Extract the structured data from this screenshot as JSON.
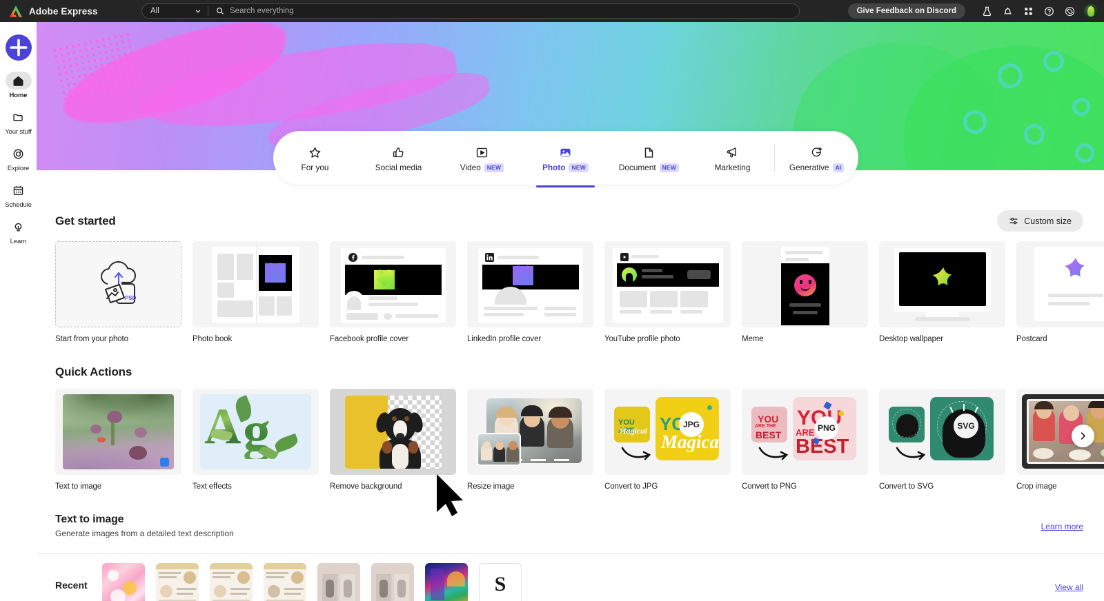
{
  "topbar": {
    "brand": "Adobe Express",
    "scope_value": "All",
    "search_placeholder": "Search everything",
    "search_value": "",
    "feedback_button": "Give Feedback on Discord",
    "icons": [
      "beaker-icon",
      "bell-icon",
      "apps-grid-icon",
      "help-icon",
      "creative-cloud-icon",
      "avatar"
    ]
  },
  "sidebar": {
    "create_button": "+",
    "items": [
      {
        "label": "Home",
        "icon": "home-icon",
        "active": true
      },
      {
        "label": "Your stuff",
        "icon": "folder-icon",
        "active": false
      },
      {
        "label": "Explore",
        "icon": "compass-icon",
        "active": false
      },
      {
        "label": "Schedule",
        "icon": "calendar-icon",
        "active": false
      },
      {
        "label": "Learn",
        "icon": "lightbulb-icon",
        "active": false
      }
    ]
  },
  "tabs": [
    {
      "label": "For you",
      "icon": "star-icon",
      "badge": "",
      "active": false
    },
    {
      "label": "Social media",
      "icon": "thumbs-up-icon",
      "badge": "",
      "active": false
    },
    {
      "label": "Video",
      "icon": "video-icon",
      "badge": "NEW",
      "active": false
    },
    {
      "label": "Photo",
      "icon": "photo-icon",
      "badge": "NEW",
      "active": true
    },
    {
      "label": "Document",
      "icon": "document-icon",
      "badge": "NEW",
      "active": false
    },
    {
      "label": "Marketing",
      "icon": "megaphone-icon",
      "badge": "",
      "active": false
    },
    {
      "label": "Generative",
      "icon": "generative-ai-icon",
      "badge": "AI",
      "active": false
    }
  ],
  "get_started": {
    "title": "Get started",
    "custom_size_button": "Custom size",
    "cards": [
      {
        "label": "Start from your photo",
        "kind": "upload"
      },
      {
        "label": "Photo book",
        "kind": "photobook"
      },
      {
        "label": "Facebook profile cover",
        "kind": "facebook"
      },
      {
        "label": "LinkedIn profile cover",
        "kind": "linkedin"
      },
      {
        "label": "YouTube profile photo",
        "kind": "youtube"
      },
      {
        "label": "Meme",
        "kind": "meme"
      },
      {
        "label": "Desktop wallpaper",
        "kind": "wallpaper"
      },
      {
        "label": "Postcard",
        "kind": "postcard"
      }
    ]
  },
  "quick_actions": {
    "title": "Quick Actions",
    "cards": [
      {
        "label": "Text to image",
        "kind": "text-to-image"
      },
      {
        "label": "Text effects",
        "kind": "text-effects"
      },
      {
        "label": "Remove background",
        "kind": "remove-bg"
      },
      {
        "label": "Resize image",
        "kind": "resize"
      },
      {
        "label": "Convert to JPG",
        "kind": "convert",
        "format": "JPG"
      },
      {
        "label": "Convert to PNG",
        "kind": "convert",
        "format": "PNG"
      },
      {
        "label": "Convert to SVG",
        "kind": "convert",
        "format": "SVG"
      },
      {
        "label": "Crop image",
        "kind": "crop"
      }
    ]
  },
  "promo": {
    "title": "Text to image",
    "subtitle": "Generate images from a detailed text description",
    "link": "Learn more"
  },
  "recent": {
    "label": "Recent",
    "view_all": "View all",
    "items": [
      "floral",
      "flyer-1",
      "flyer-2",
      "flyer-3",
      "couple-1",
      "couple-2",
      "abstract",
      "letter-s"
    ]
  },
  "colors": {
    "accent": "#4b43d8",
    "topbar_bg": "#252525",
    "badge_bg": "#d9d8fb"
  }
}
